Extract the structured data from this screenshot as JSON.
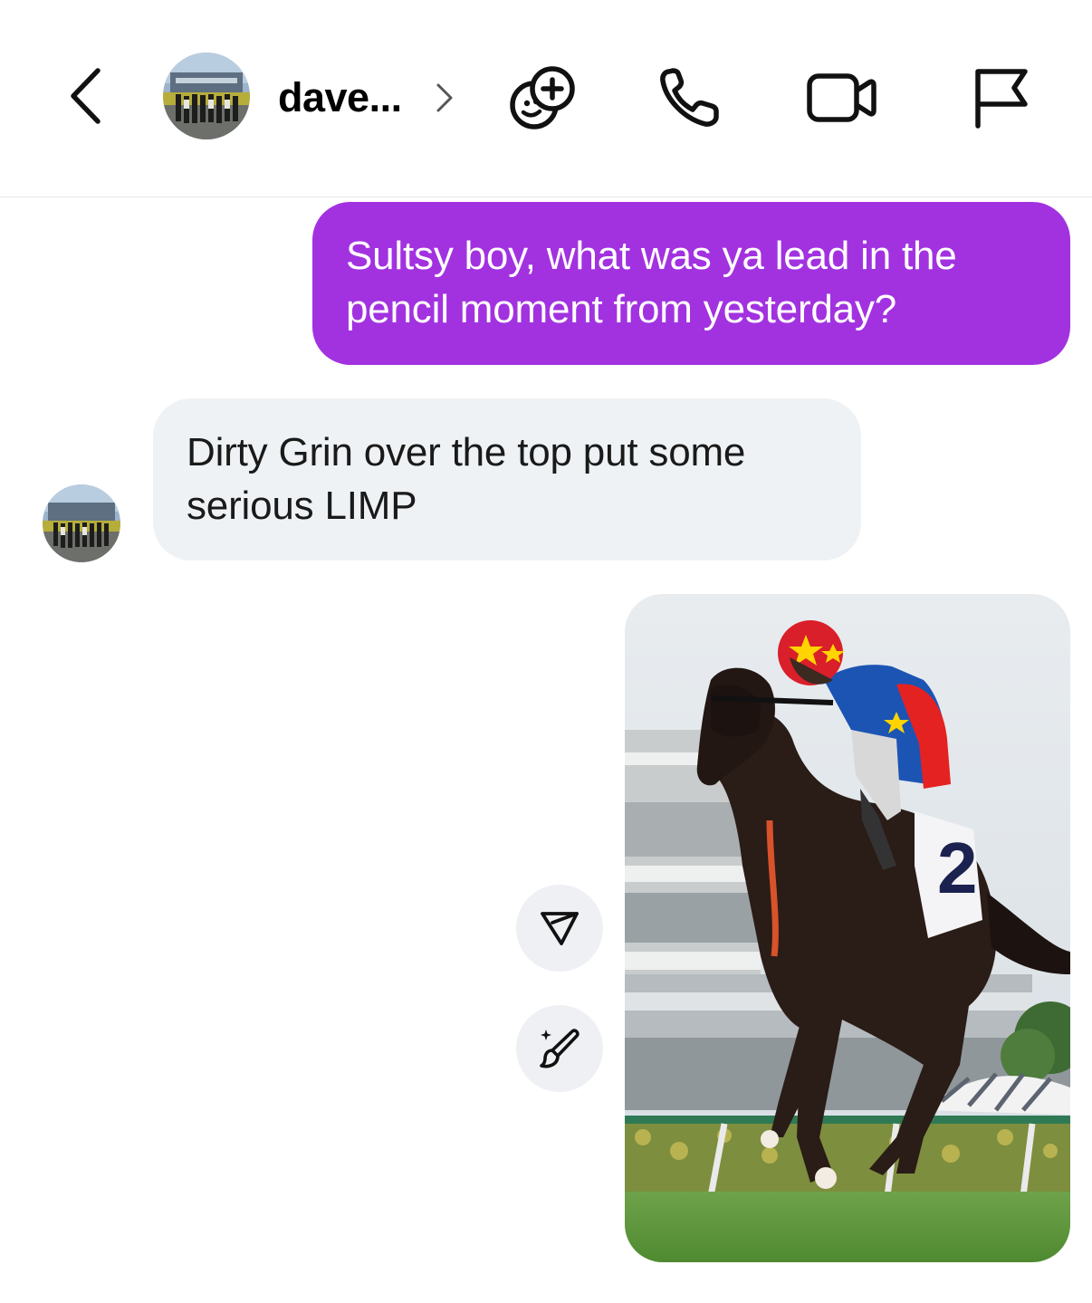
{
  "header": {
    "back_icon": "chevron-left-icon",
    "contact_name": "dave...",
    "contact_chevron_icon": "chevron-right-icon",
    "actions": [
      {
        "name": "effects",
        "icon": "sticker-add-icon"
      },
      {
        "name": "call",
        "icon": "phone-icon"
      },
      {
        "name": "video",
        "icon": "video-camera-icon"
      },
      {
        "name": "report",
        "icon": "flag-icon"
      }
    ]
  },
  "messages": [
    {
      "direction": "outgoing",
      "text": "Sultsy boy, what was ya lead in the pencil moment from yesterday?"
    },
    {
      "direction": "incoming",
      "text": "Dirty Grin over the top put some serious LIMP"
    },
    {
      "direction": "outgoing",
      "type": "photo",
      "photo_label": "2"
    }
  ],
  "photo_actions": [
    {
      "name": "share",
      "icon": "paper-plane-icon"
    },
    {
      "name": "ai-edit",
      "icon": "sparkle-brush-icon"
    }
  ],
  "colors": {
    "outgoing_bubble": "#a232e0",
    "incoming_bubble": "#eff2f5",
    "icon": "#111111"
  }
}
